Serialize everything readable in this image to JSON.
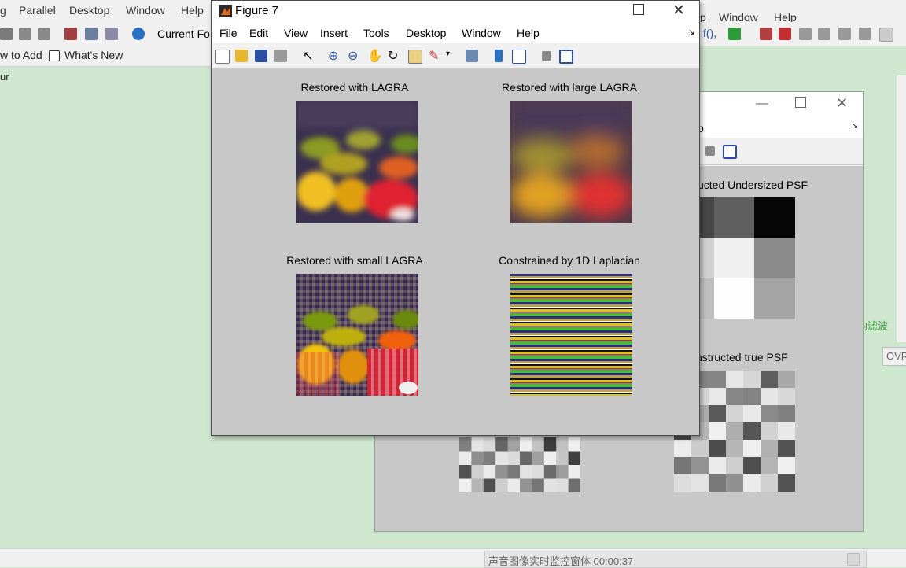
{
  "desktop": {
    "menu": [
      "g",
      "Parallel",
      "Desktop",
      "Window",
      "Help"
    ],
    "menu_right": [
      "p",
      "Window",
      "Help"
    ],
    "current_folder_label": "Current Fo",
    "shortcuts": {
      "add": "w to Add",
      "whats_new": "What's New"
    },
    "left_text": "ur",
    "cn_text": "的滤波",
    "ovr": "OVR",
    "taskbar_text": "声音图像实时监控窗体 00:00:37"
  },
  "figure7": {
    "title": "Figure 7",
    "menu": [
      "File",
      "Edit",
      "View",
      "Insert",
      "Tools",
      "Desktop",
      "Window",
      "Help"
    ],
    "axes": [
      {
        "title": "Restored with LAGRA"
      },
      {
        "title": "Restored with large LAGRA"
      },
      {
        "title": "Restored with small LAGRA"
      },
      {
        "title": "Constrained by 1D Laplacian"
      }
    ]
  },
  "figure_behind": {
    "menu_partial": "p",
    "titles": {
      "undersized": "ucted Undersized PSF",
      "true_psf": "nstructed true PSF"
    }
  },
  "colors": {
    "canvas": "#c8c8c8",
    "desktop_bg": "#cfe6cf"
  }
}
